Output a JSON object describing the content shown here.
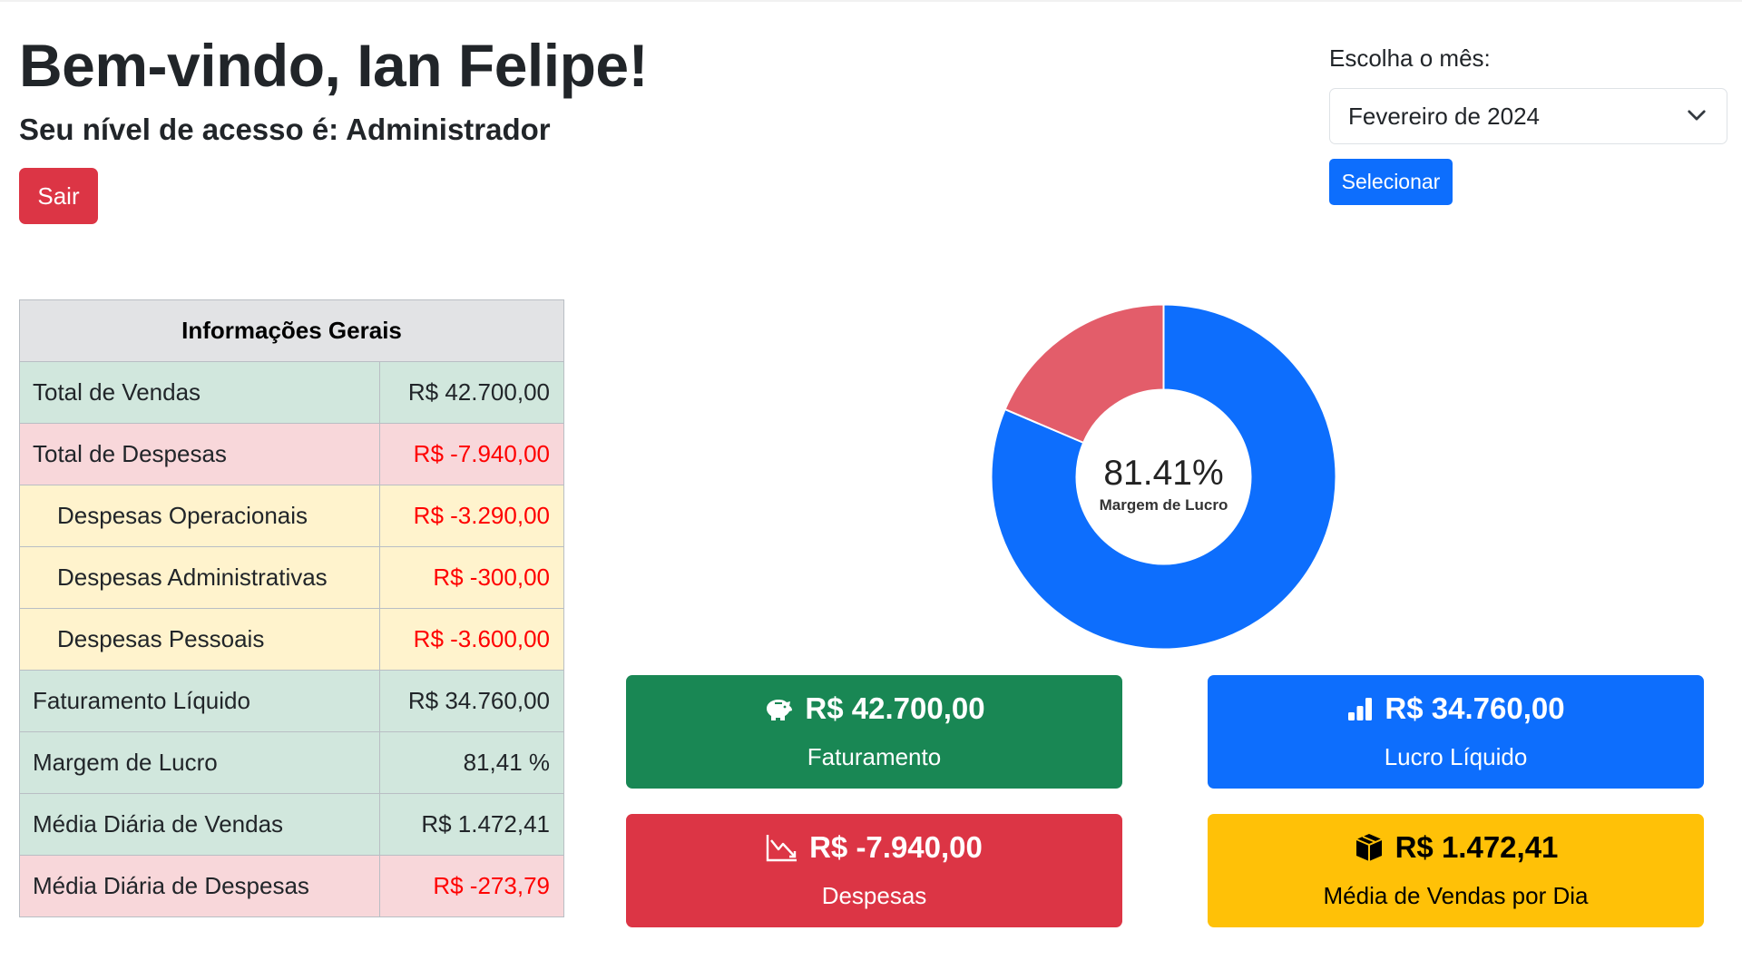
{
  "header": {
    "welcome": "Bem-vindo, Ian Felipe!",
    "access_level": "Seu nível de acesso é: Administrador",
    "logout_label": "Sair"
  },
  "month_picker": {
    "label": "Escolha o mês:",
    "selected": "Fevereiro de 2024",
    "submit_label": "Selecionar"
  },
  "info_table": {
    "title": "Informações Gerais",
    "rows": [
      {
        "label": "Total de Vendas",
        "value": "R$ 42.700,00",
        "style": "green"
      },
      {
        "label": "Total de Despesas",
        "value": "R$ -7.940,00",
        "style": "red"
      },
      {
        "label": "Despesas Operacionais",
        "value": "R$ -3.290,00",
        "style": "yellow"
      },
      {
        "label": "Despesas Administrativas",
        "value": "R$ -300,00",
        "style": "yellow"
      },
      {
        "label": "Despesas Pessoais",
        "value": "R$ -3.600,00",
        "style": "yellow"
      },
      {
        "label": "Faturamento Líquido",
        "value": "R$ 34.760,00",
        "style": "green"
      },
      {
        "label": "Margem de Lucro",
        "value": "81,41 %",
        "style": "green"
      },
      {
        "label": "Média Diária de Vendas",
        "value": "R$ 1.472,41",
        "style": "green"
      },
      {
        "label": "Média Diária de Despesas",
        "value": "R$ -273,79",
        "style": "red"
      }
    ]
  },
  "chart_data": {
    "type": "pie",
    "variant": "doughnut",
    "center_value": "81.41%",
    "center_label": "Margem de Lucro",
    "slices": [
      {
        "value": 81.41,
        "color": "#0d6efd"
      },
      {
        "value": 18.59,
        "color": "#e35d6a"
      }
    ]
  },
  "cards": {
    "revenue": {
      "amount": "R$ 42.700,00",
      "caption": "Faturamento",
      "icon": "piggy-bank-icon",
      "color": "#198754"
    },
    "profit": {
      "amount": "R$ 34.760,00",
      "caption": "Lucro Líquido",
      "icon": "bar-chart-icon",
      "color": "#0d6efd"
    },
    "expenses": {
      "amount": "R$ -7.940,00",
      "caption": "Despesas",
      "icon": "graph-down-icon",
      "color": "#dc3545"
    },
    "daily_avg": {
      "amount": "R$ 1.472,41",
      "caption": "Média de Vendas por Dia",
      "icon": "box-icon",
      "color": "#ffc107"
    }
  },
  "colors": {
    "danger": "#dc3545",
    "primary": "#0d6efd",
    "success": "#198754",
    "warning": "#ffc107",
    "negative_text": "#ff0000"
  }
}
